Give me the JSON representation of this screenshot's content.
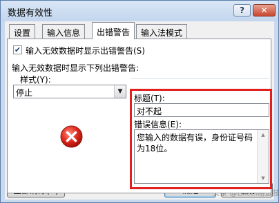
{
  "window": {
    "title": "数据有效性",
    "help_label": "?",
    "close_label": "✕"
  },
  "tabs": [
    {
      "label": "设置",
      "active": false
    },
    {
      "label": "输入信息",
      "active": false
    },
    {
      "label": "出错警告",
      "active": true
    },
    {
      "label": "输入法模式",
      "active": false
    }
  ],
  "error_alert": {
    "show_checkbox_label": "输入无效数据时显示出错警告(S)",
    "show_checkbox_checked": true,
    "group_label": "输入无效数据时显示下列出错警告:",
    "style_label": "样式(Y):",
    "style_value": "停止",
    "title_label": "标题(T):",
    "title_value": "对不起",
    "message_label": "错误信息(E):",
    "message_value": "您输入的数据有误，身份证号码为18位。",
    "icon": "error-stop-icon",
    "highlight_color": "#e21f1f"
  },
  "buttons": {
    "clear_all": "全部清除(C)",
    "ok": "确定",
    "cancel": "取消"
  },
  "watermark": "头条 @Excel精选技巧"
}
